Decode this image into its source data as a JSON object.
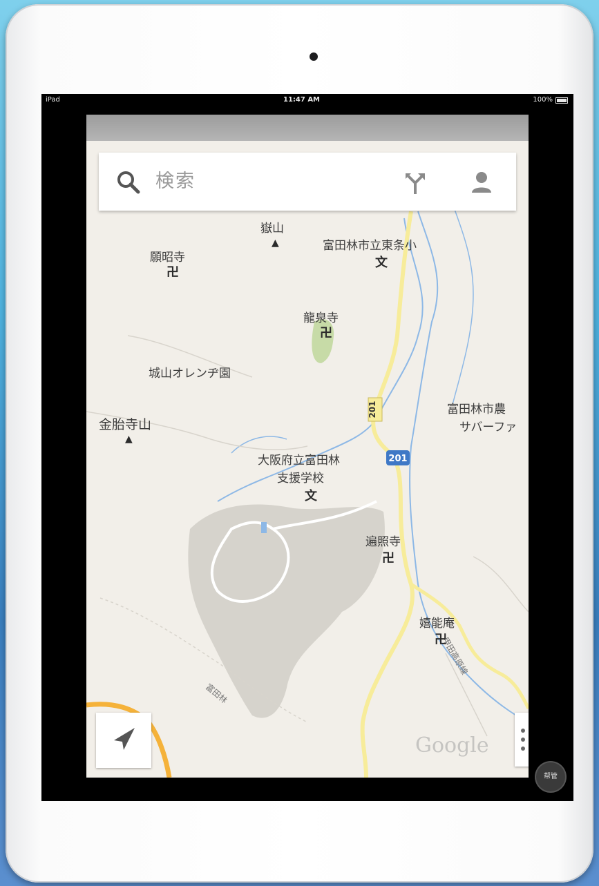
{
  "status_bar": {
    "device": "iPad",
    "time": "11:47 AM",
    "battery": "100%"
  },
  "search": {
    "placeholder": "検索"
  },
  "icons": {
    "search": "search-icon",
    "directions": "directions-icon",
    "account": "person-icon",
    "location": "location-arrow-icon",
    "more": "more-vertical-icon"
  },
  "map": {
    "labels": [
      {
        "name": "mountain-label",
        "text": "嶽山"
      },
      {
        "name": "school-label",
        "text": "富田林市立東条小"
      },
      {
        "name": "temple-label",
        "text": "願昭寺"
      },
      {
        "name": "temple-label",
        "text": "龍泉寺"
      },
      {
        "name": "park-label",
        "text": "城山オレンヂ園"
      },
      {
        "name": "mountain-label",
        "text": "金胎寺山"
      },
      {
        "name": "farm-label-1",
        "text": "富田林市農"
      },
      {
        "name": "farm-label-2",
        "text": "サバーファ"
      },
      {
        "name": "school-label-1",
        "text": "大阪府立富田林"
      },
      {
        "name": "school-label-2",
        "text": "支援学校"
      },
      {
        "name": "temple-label",
        "text": "遍照寺"
      },
      {
        "name": "temple-label",
        "text": "嬉能庵"
      }
    ],
    "symbols": {
      "temple": "卍",
      "school": "文",
      "mountain": "▲"
    },
    "route_shields": [
      "201",
      "201"
    ],
    "road_labels": [
      "富田林",
      "甲田高原線"
    ],
    "watermark": "Google"
  },
  "corner_badge": "帮管"
}
